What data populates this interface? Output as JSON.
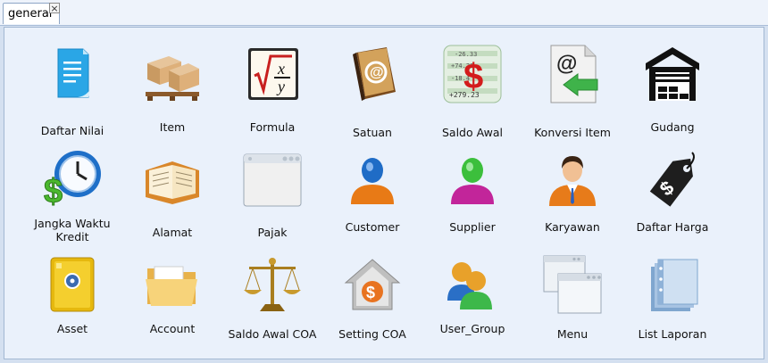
{
  "tab": {
    "label": "general",
    "close": "×"
  },
  "rows": [
    [
      {
        "label": "Daftar Nilai",
        "icon": "document-icon"
      },
      {
        "label": "Item",
        "icon": "boxes-pallet-icon"
      },
      {
        "label": "Formula",
        "icon": "formula-icon"
      },
      {
        "label": "Satuan",
        "icon": "address-book-icon"
      },
      {
        "label": "Saldo Awal",
        "icon": "ledger-dollar-icon"
      },
      {
        "label": "Konversi Item",
        "icon": "email-arrow-icon"
      },
      {
        "label": "Gudang",
        "icon": "warehouse-icon"
      }
    ],
    [
      {
        "label": "Jangka Waktu Kredit",
        "icon": "clock-dollar-icon"
      },
      {
        "label": "Alamat",
        "icon": "open-book-icon"
      },
      {
        "label": "Pajak",
        "icon": "window-icon"
      },
      {
        "label": "Customer",
        "icon": "user-blue-icon"
      },
      {
        "label": "Supplier",
        "icon": "user-green-icon"
      },
      {
        "label": "Karyawan",
        "icon": "employee-icon"
      },
      {
        "label": "Daftar Harga",
        "icon": "price-tag-icon"
      }
    ],
    [
      {
        "label": "Asset",
        "icon": "safe-icon"
      },
      {
        "label": "Account",
        "icon": "folder-icon"
      },
      {
        "label": "Saldo Awal COA",
        "icon": "scales-icon"
      },
      {
        "label": "Setting COA",
        "icon": "house-dollar-icon"
      },
      {
        "label": "User_Group",
        "icon": "user-group-icon"
      },
      {
        "label": "Menu",
        "icon": "windows-stack-icon"
      },
      {
        "label": "List Laporan",
        "icon": "binders-icon"
      }
    ]
  ]
}
